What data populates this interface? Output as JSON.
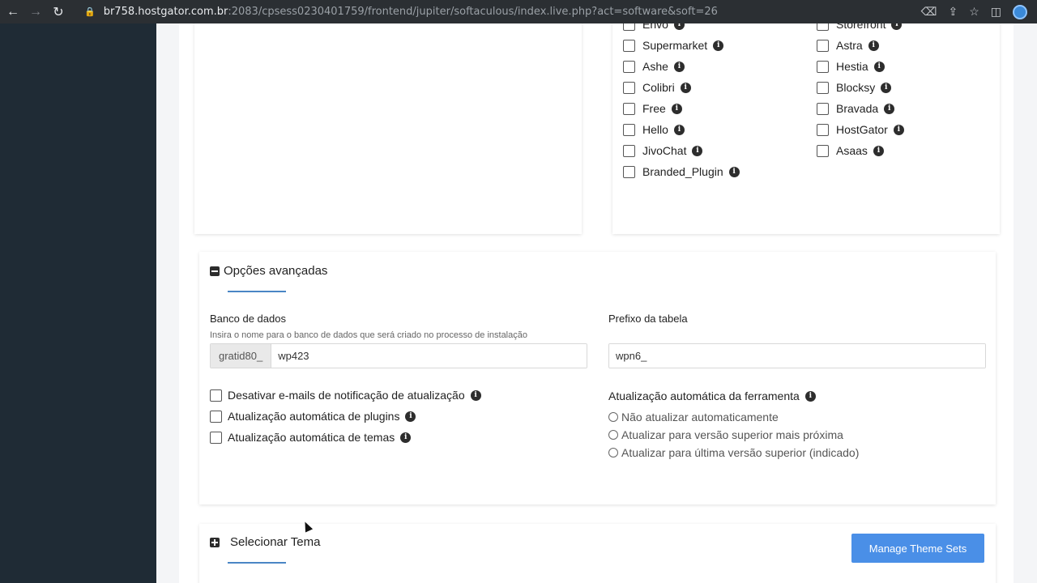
{
  "browser": {
    "url_host": "br758.hostgator.com.br",
    "url_path": ":2083/cpsess0230401759/frontend/jupiter/softaculous/index.live.php?act=software&soft=26"
  },
  "plugins": {
    "left_column": [
      "Envo",
      "Supermarket",
      "Ashe",
      "Colibri",
      "Free",
      "Hello",
      "JivoChat",
      "Branded_Plugin"
    ],
    "right_column": [
      "Storefront",
      "Astra",
      "Hestia",
      "Blocksy",
      "Bravada",
      "HostGator",
      "Asaas"
    ]
  },
  "advanced": {
    "title": "Opções avançadas",
    "database_label": "Banco de dados",
    "database_hint": "Insira o nome para o banco de dados que será criado no processo de instalação",
    "database_prefix": "gratid80_",
    "database_value": "wp423",
    "table_prefix_label": "Prefixo da tabela",
    "table_prefix_value": "wpn6_",
    "checkboxes": [
      "Desativar e-mails de notificação de atualização",
      "Atualização automática de plugins",
      "Atualização automática de temas"
    ],
    "auto_update_label": "Atualização automática da ferramenta",
    "radios": [
      "Não atualizar automaticamente",
      "Atualizar para versão superior mais próxima",
      "Atualizar para última versão superior (indicado)"
    ]
  },
  "theme": {
    "title": "Selecionar Tema",
    "manage_button": "Manage Theme Sets"
  }
}
